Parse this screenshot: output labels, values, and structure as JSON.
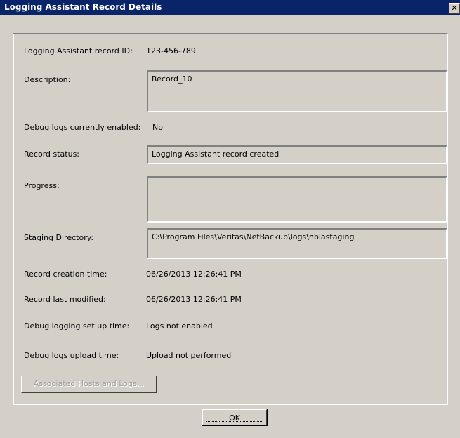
{
  "window": {
    "title": "Logging Assistant Record Details",
    "close_glyph": "✕"
  },
  "fields": {
    "record_id_label": "Logging Assistant record ID:",
    "record_id_value": "123-456-789",
    "description_label": "Description:",
    "description_value": "Record_10",
    "debug_enabled_label": "Debug logs currently enabled:",
    "debug_enabled_value": "No",
    "record_status_label": "Record status:",
    "record_status_value": "Logging Assistant record created",
    "progress_label": "Progress:",
    "progress_value": "",
    "staging_dir_label": "Staging Directory:",
    "staging_dir_value": "C:\\Program Files\\Veritas\\NetBackup\\logs\\nblastaging",
    "creation_time_label": "Record creation time:",
    "creation_time_value": "06/26/2013 12:26:41 PM",
    "last_modified_label": "Record last modified:",
    "last_modified_value": "06/26/2013 12:26:41 PM",
    "debug_setup_label": "Debug logging set up time:",
    "debug_setup_value": "Logs not enabled",
    "upload_time_label": "Debug logs upload time:",
    "upload_time_value": "Upload not performed"
  },
  "buttons": {
    "associated_hosts_label": "Associated Hosts and Logs...",
    "ok_label": "OK"
  },
  "colors": {
    "titlebar": "#0a246a",
    "dialog_background": "#d4d0c8",
    "disabled_text": "#a0a0a0"
  }
}
